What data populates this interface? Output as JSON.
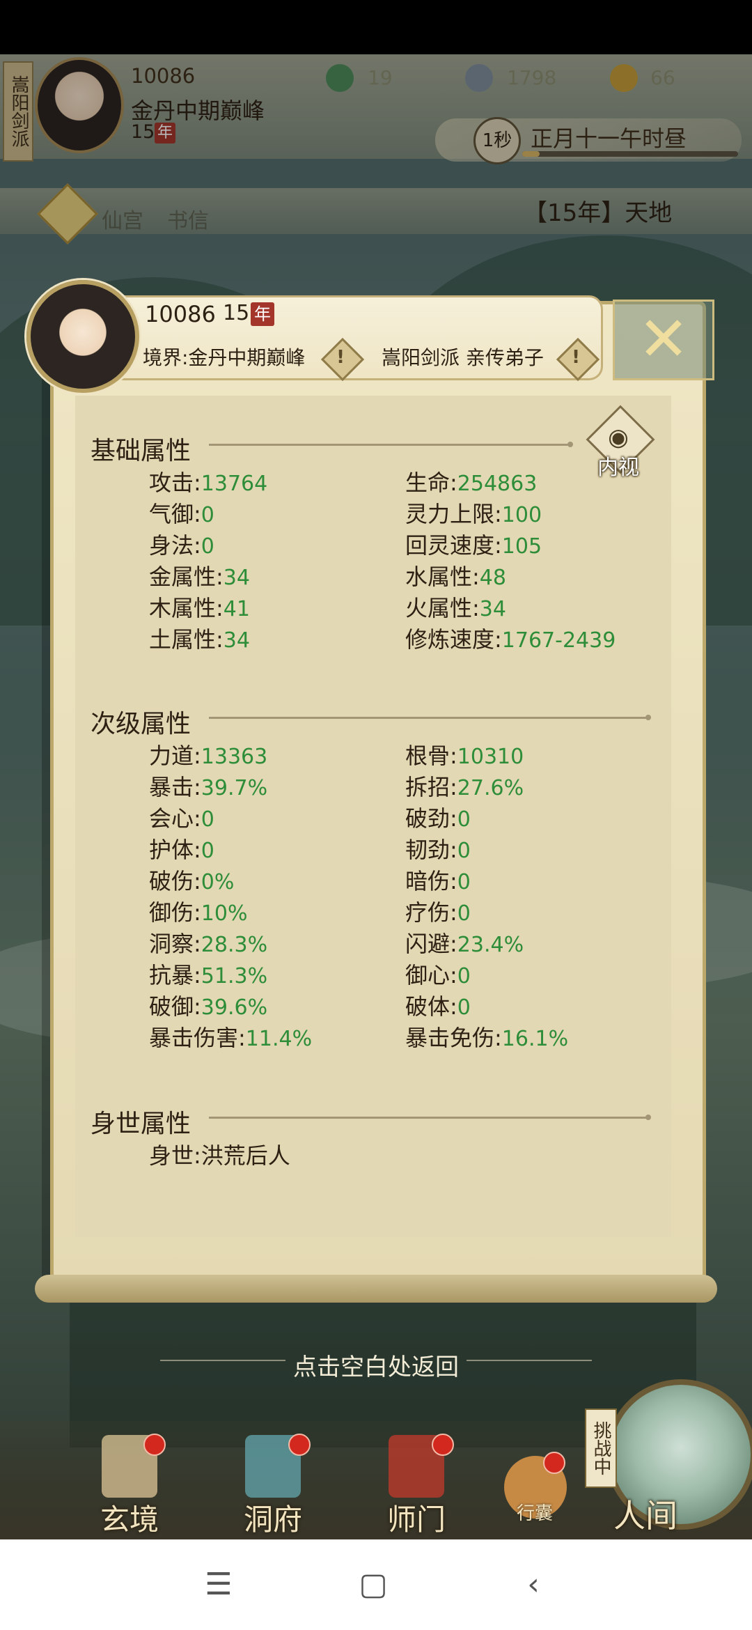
{
  "hud": {
    "sect_name": "嵩阳剑派",
    "player_id": "10086",
    "realm": "金丹中期巅峰",
    "age": "15",
    "age_badge": "年",
    "res1": "19",
    "res2": "1798",
    "res3": "66",
    "speed_label": "1秒",
    "time_text": "正月十一午时昼",
    "time_progress": 0.08,
    "menu1": "仙宫",
    "menu2": "书信",
    "year_title": "【15年】天地"
  },
  "panel": {
    "player_id": "10086",
    "age": "15",
    "age_badge": "年",
    "realm_label": "境界:金丹中期巅峰",
    "sect_label": "嵩阳剑派 亲传弟子",
    "inner_view_label": "内视",
    "sections": {
      "basic": "基础属性",
      "secondary": "次级属性",
      "background": "身世属性"
    },
    "basic_stats": [
      {
        "label": "攻击:",
        "value": "13764"
      },
      {
        "label": "生命:",
        "value": "254863"
      },
      {
        "label": "气御:",
        "value": "0"
      },
      {
        "label": "灵力上限:",
        "value": "100"
      },
      {
        "label": "身法:",
        "value": "0"
      },
      {
        "label": "回灵速度:",
        "value": "105"
      },
      {
        "label": "金属性:",
        "value": "34"
      },
      {
        "label": "水属性:",
        "value": "48"
      },
      {
        "label": "木属性:",
        "value": "41"
      },
      {
        "label": "火属性:",
        "value": "34"
      },
      {
        "label": "土属性:",
        "value": "34"
      },
      {
        "label": "修炼速度:",
        "value": "1767-2439"
      }
    ],
    "secondary_stats": [
      {
        "label": "力道:",
        "value": "13363"
      },
      {
        "label": "根骨:",
        "value": "10310"
      },
      {
        "label": "暴击:",
        "value": "39.7%"
      },
      {
        "label": "拆招:",
        "value": "27.6%"
      },
      {
        "label": "会心:",
        "value": "0"
      },
      {
        "label": "破劲:",
        "value": "0"
      },
      {
        "label": "护体:",
        "value": "0"
      },
      {
        "label": "韧劲:",
        "value": "0"
      },
      {
        "label": "破伤:",
        "value": "0%"
      },
      {
        "label": "暗伤:",
        "value": "0"
      },
      {
        "label": "御伤:",
        "value": "10%"
      },
      {
        "label": "疗伤:",
        "value": "0"
      },
      {
        "label": "洞察:",
        "value": "28.3%"
      },
      {
        "label": "闪避:",
        "value": "23.4%"
      },
      {
        "label": "抗暴:",
        "value": "51.3%"
      },
      {
        "label": "御心:",
        "value": "0"
      },
      {
        "label": "破御:",
        "value": "39.6%"
      },
      {
        "label": "破体:",
        "value": "0"
      },
      {
        "label": "暴击伤害:",
        "value": "11.4%"
      },
      {
        "label": "暴击免伤:",
        "value": "16.1%"
      }
    ],
    "background_stats": [
      {
        "label": "身世:",
        "value": "洪荒后人"
      }
    ]
  },
  "dismiss_hint": "点击空白处返回",
  "bottom_nav": {
    "items": [
      "玄境",
      "洞府",
      "师门",
      "行囊"
    ],
    "challenge_tag": "挑战中",
    "world_label": "人间"
  },
  "system_nav": {
    "menu": "☰",
    "home": "▢",
    "back": "‹"
  },
  "colors": {
    "stat_value": "#2e8d39",
    "panel_bg": "#e3d8b4",
    "badge_red": "#a3352a"
  }
}
